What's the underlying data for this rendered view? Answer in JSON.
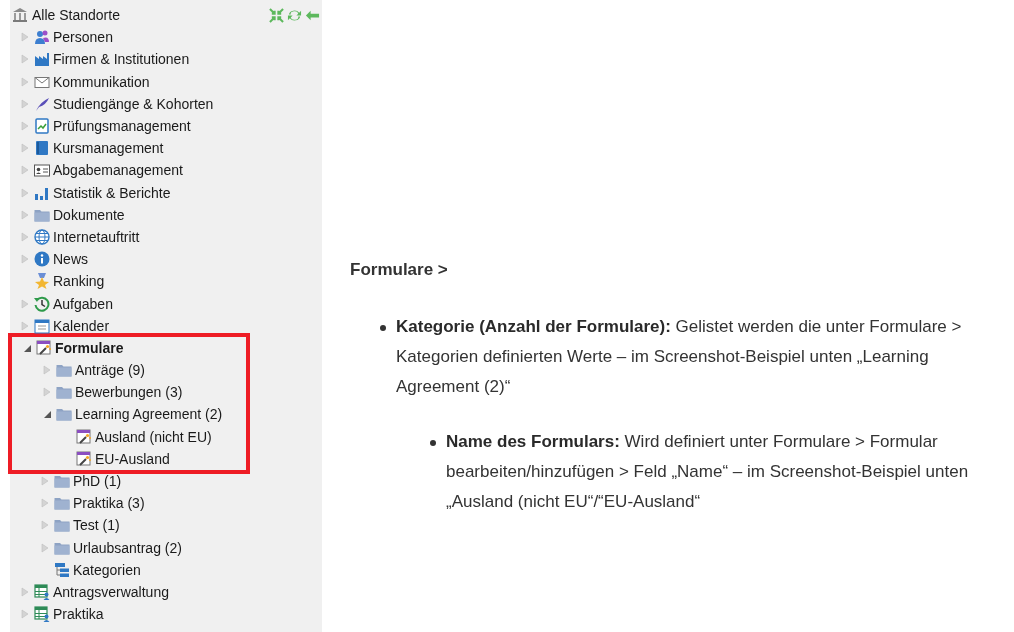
{
  "tree": {
    "root": {
      "label": "Alle Standorte"
    },
    "items": [
      {
        "kind": "persons",
        "label": "Personen",
        "expanded": false,
        "selected": false,
        "highlighted": false
      },
      {
        "kind": "companies",
        "label": "Firmen & Institutionen",
        "expanded": false,
        "selected": false,
        "highlighted": false
      },
      {
        "kind": "communication",
        "label": "Kommunikation",
        "expanded": false,
        "selected": false,
        "highlighted": false
      },
      {
        "kind": "programs",
        "label": "Studiengänge & Kohorten",
        "expanded": false,
        "selected": false,
        "highlighted": false
      },
      {
        "kind": "exams",
        "label": "Prüfungsmanagement",
        "expanded": false,
        "selected": false,
        "highlighted": false
      },
      {
        "kind": "courses",
        "label": "Kursmanagement",
        "expanded": false,
        "selected": false,
        "highlighted": false
      },
      {
        "kind": "submissions",
        "label": "Abgabemanagement",
        "expanded": false,
        "selected": false,
        "highlighted": false
      },
      {
        "kind": "statistics",
        "label": "Statistik & Berichte",
        "expanded": false,
        "selected": false,
        "highlighted": false
      },
      {
        "kind": "documents",
        "label": "Dokumente",
        "expanded": false,
        "selected": false,
        "highlighted": false
      },
      {
        "kind": "website",
        "label": "Internetauftritt",
        "expanded": false,
        "selected": false,
        "highlighted": false
      },
      {
        "kind": "news",
        "label": "News",
        "expanded": false,
        "selected": false,
        "highlighted": false
      },
      {
        "kind": "ranking",
        "label": "Ranking",
        "selected": false,
        "highlighted": false
      },
      {
        "kind": "tasks",
        "label": "Aufgaben",
        "expanded": false,
        "selected": false,
        "highlighted": false
      },
      {
        "kind": "calendar",
        "label": "Kalender",
        "expanded": false,
        "selected": false,
        "highlighted": false
      },
      {
        "kind": "forms",
        "label": "Formulare",
        "expanded": true,
        "selected": true,
        "highlighted": true,
        "children": [
          {
            "kind": "folder",
            "label": "Anträge (9)",
            "expanded": false,
            "selected": false,
            "highlighted": true
          },
          {
            "kind": "folder",
            "label": "Bewerbungen (3)",
            "expanded": false,
            "selected": false,
            "highlighted": true
          },
          {
            "kind": "folder",
            "label": "Learning Agreement (2)",
            "expanded": true,
            "selected": false,
            "highlighted": true,
            "children": [
              {
                "kind": "form",
                "label": "Ausland (nicht EU)",
                "selected": false,
                "highlighted": true
              },
              {
                "kind": "form",
                "label": "EU-Ausland",
                "selected": false,
                "highlighted": true
              }
            ]
          },
          {
            "kind": "folder",
            "label": "PhD (1)",
            "expanded": false,
            "selected": false,
            "highlighted": false
          },
          {
            "kind": "folder",
            "label": "Praktika (3)",
            "expanded": false,
            "selected": false,
            "highlighted": false
          },
          {
            "kind": "folder",
            "label": "Test (1)",
            "expanded": false,
            "selected": false,
            "highlighted": false
          },
          {
            "kind": "folder",
            "label": "Urlaubsantrag (2)",
            "expanded": false,
            "selected": false,
            "highlighted": false
          },
          {
            "kind": "categories",
            "label": "Kategorien",
            "selected": false,
            "highlighted": false
          }
        ]
      },
      {
        "kind": "applications",
        "label": "Antragsverwaltung",
        "expanded": false,
        "selected": false,
        "highlighted": false
      },
      {
        "kind": "internships",
        "label": "Praktika",
        "expanded": false,
        "selected": false,
        "highlighted": false
      }
    ]
  },
  "doc": {
    "heading": "Formulare >",
    "bullets": [
      {
        "text": "**Kategorie (Anzahl der Formulare):** Gelistet werden die unter Formulare > Kategorien definierten Werte – im Screenshot-Beispiel unten „Learning Agreement (2)“",
        "children": [
          {
            "text": "**Name des Formulars:** Wird definiert unter Formulare > Formular bearbeiten/hinzufügen > Feld „Name“ – im Screenshot-Beispiel unten „Ausland (nicht EU“/“EU-Ausland“"
          }
        ]
      }
    ]
  }
}
